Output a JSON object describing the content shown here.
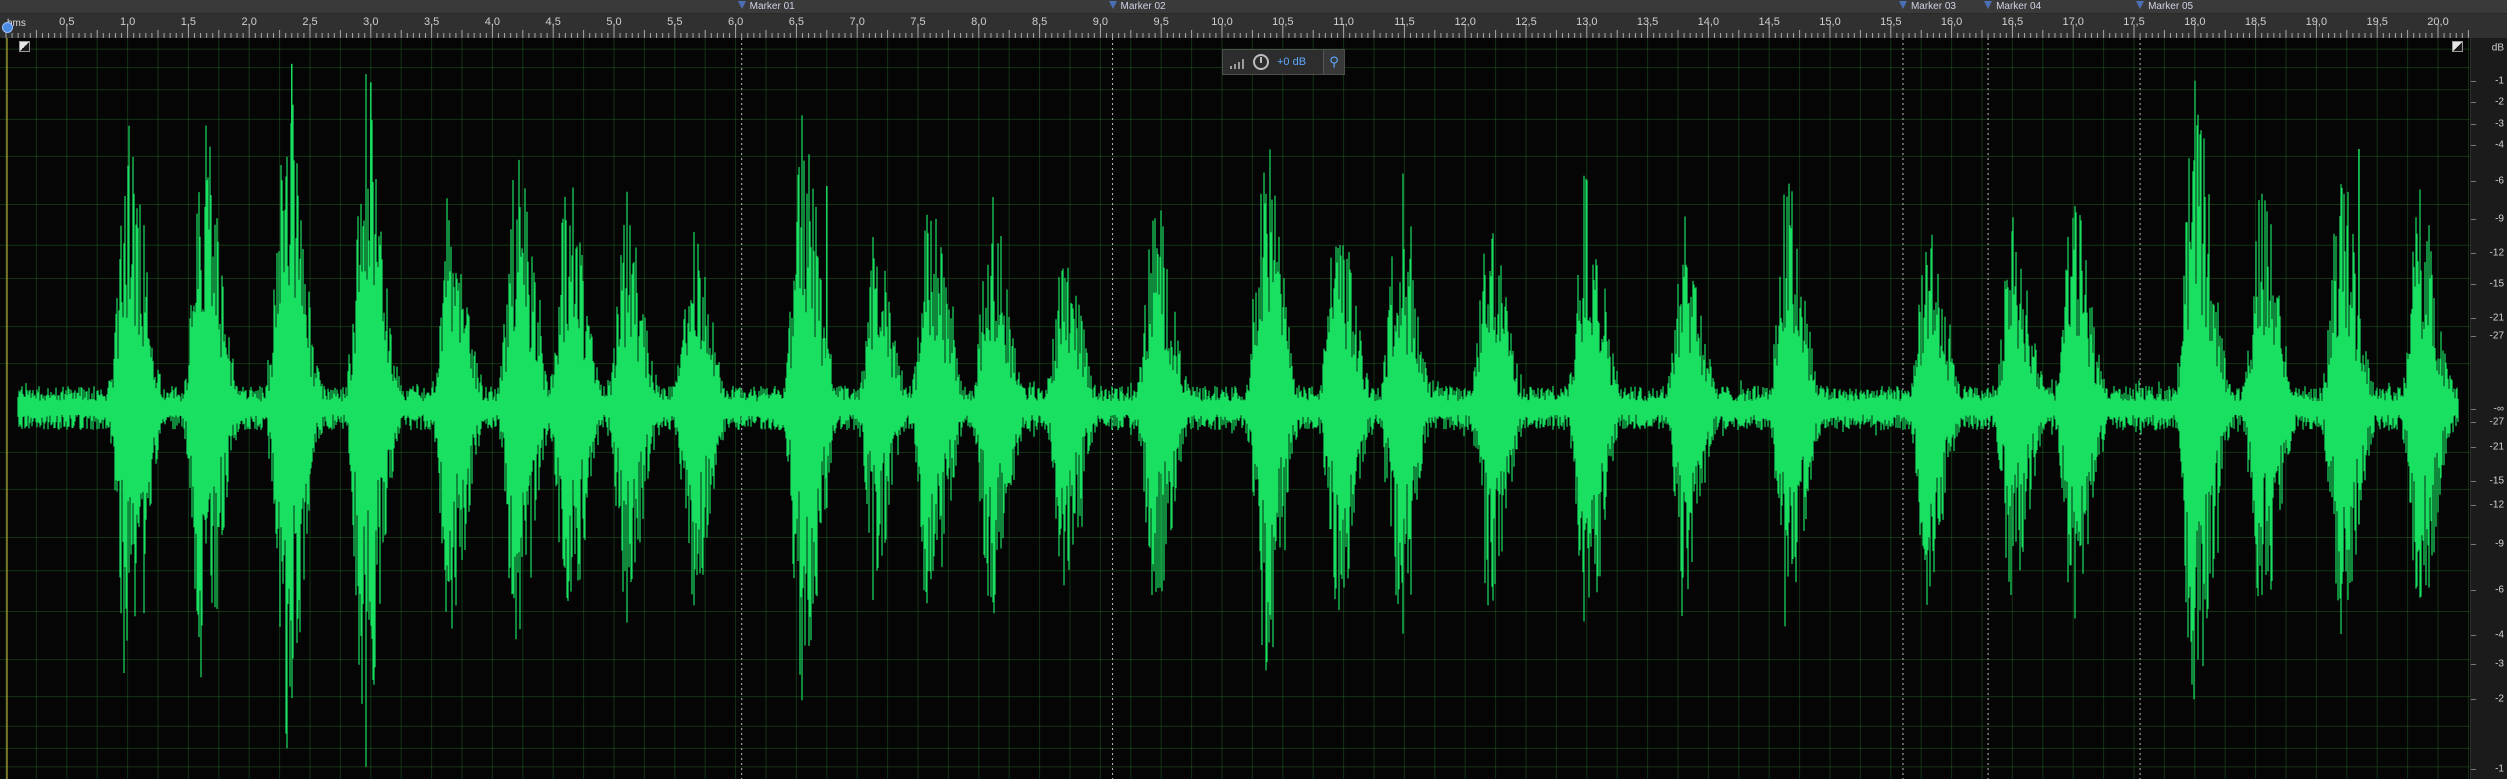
{
  "ruler": {
    "unit": "hms",
    "start": 0,
    "end": 20.25,
    "major_step": 0.5,
    "minor_ticks": 10,
    "tick_labels": [
      "0,5",
      "1,0",
      "1,5",
      "2,0",
      "2,5",
      "3,0",
      "3,5",
      "4,0",
      "4,5",
      "5,0",
      "5,5",
      "6,0",
      "6,5",
      "7,0",
      "7,5",
      "8,0",
      "8,5",
      "9,0",
      "9,5",
      "10,0",
      "10,5",
      "11,0",
      "11,5",
      "12,0",
      "12,5",
      "13,0",
      "13,5",
      "14,0",
      "14,5",
      "15,0",
      "15,5",
      "16,0",
      "16,5",
      "17,0",
      "17,5",
      "18,0",
      "18,5",
      "19,0",
      "19,5",
      "20,0"
    ]
  },
  "markers": [
    {
      "label": "Marker 01",
      "time": 6.05
    },
    {
      "label": "Marker 02",
      "time": 9.1
    },
    {
      "label": "Marker 03",
      "time": 15.6
    },
    {
      "label": "Marker 04",
      "time": 16.3
    },
    {
      "label": "Marker 05",
      "time": 17.55
    }
  ],
  "hud": {
    "volume": "+0 dB"
  },
  "db_scale": {
    "unit": "dB",
    "upper": [
      "-1",
      "-2",
      "-3",
      "-4",
      "-6",
      "-9",
      "-12",
      "-15",
      "-21",
      "-27"
    ],
    "center": "-∞",
    "lower": [
      "-27",
      "-21",
      "-15",
      "-12",
      "-9",
      "-6",
      "-4",
      "-3",
      "-2",
      "-1"
    ]
  },
  "icons": {
    "pin": "pin-icon",
    "knob": "volume-knob-icon",
    "meter": "level-meter-icon"
  },
  "colors": {
    "waveform": "#19e060",
    "grid": "#1f5a1f",
    "marker_line": "#bbbbbb",
    "accent": "#5fa8ff"
  },
  "waveform": {
    "bursts": [
      {
        "t": 1.0,
        "a": 0.8
      },
      {
        "t": 1.62,
        "a": 0.82
      },
      {
        "t": 2.3,
        "a": 0.95
      },
      {
        "t": 2.95,
        "a": 0.9
      },
      {
        "t": 3.65,
        "a": 0.62
      },
      {
        "t": 4.2,
        "a": 0.7
      },
      {
        "t": 4.62,
        "a": 0.65
      },
      {
        "t": 5.1,
        "a": 0.55
      },
      {
        "t": 5.65,
        "a": 0.55
      },
      {
        "t": 6.55,
        "a": 0.8
      },
      {
        "t": 7.15,
        "a": 0.45
      },
      {
        "t": 7.6,
        "a": 0.6
      },
      {
        "t": 8.1,
        "a": 0.58
      },
      {
        "t": 8.7,
        "a": 0.48
      },
      {
        "t": 9.45,
        "a": 0.58
      },
      {
        "t": 10.35,
        "a": 0.75
      },
      {
        "t": 10.95,
        "a": 0.58
      },
      {
        "t": 11.45,
        "a": 0.55
      },
      {
        "t": 12.2,
        "a": 0.55
      },
      {
        "t": 13.0,
        "a": 0.65
      },
      {
        "t": 13.8,
        "a": 0.52
      },
      {
        "t": 14.65,
        "a": 0.62
      },
      {
        "t": 15.8,
        "a": 0.5
      },
      {
        "t": 16.5,
        "a": 0.52
      },
      {
        "t": 17.0,
        "a": 0.58
      },
      {
        "t": 18.0,
        "a": 0.9
      },
      {
        "t": 18.55,
        "a": 0.6
      },
      {
        "t": 19.2,
        "a": 0.65
      },
      {
        "t": 19.85,
        "a": 0.6
      }
    ],
    "noise_floor": 0.06
  }
}
